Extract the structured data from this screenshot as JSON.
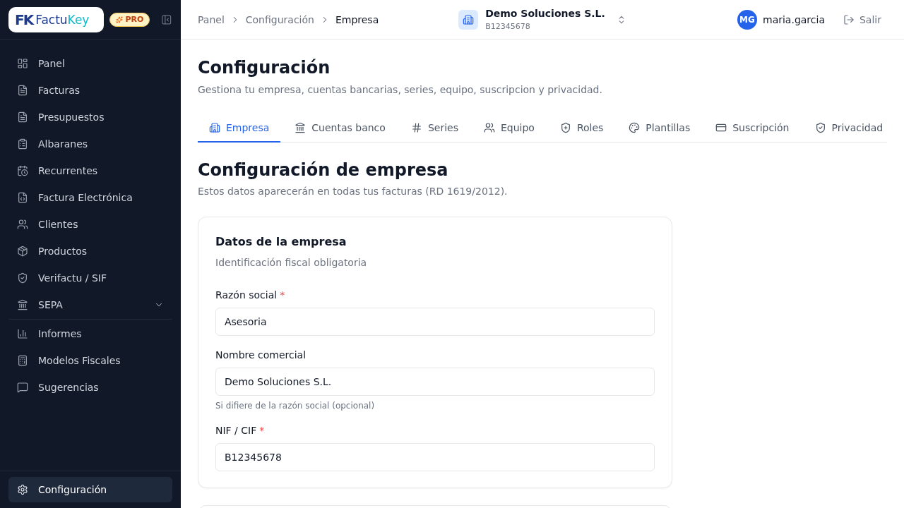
{
  "sidebar": {
    "logo": {
      "mark": "FK",
      "word_start": "Factu",
      "word_end": "Key"
    },
    "plan_badge": "PRO",
    "nav_groups": [
      {
        "items": [
          {
            "kind": "link",
            "label": "Panel",
            "selected": false
          },
          {
            "kind": "link",
            "label": "Facturas",
            "selected": false
          },
          {
            "kind": "link",
            "label": "Presupuestos",
            "selected": false
          },
          {
            "kind": "link",
            "label": "Albaranes",
            "selected": false
          },
          {
            "kind": "link",
            "label": "Recurrentes",
            "selected": false
          },
          {
            "kind": "link",
            "label": "Factura Electrónica",
            "selected": false
          },
          {
            "kind": "link",
            "label": "Clientes",
            "selected": false
          },
          {
            "kind": "link",
            "label": "Productos",
            "selected": false
          },
          {
            "kind": "link",
            "label": "Verifactu / SIF",
            "selected": false
          },
          {
            "kind": "group",
            "label": "SEPA",
            "selected": false,
            "expanded": false
          }
        ]
      },
      {
        "items": [
          {
            "kind": "link",
            "label": "Informes",
            "selected": false
          },
          {
            "kind": "link",
            "label": "Modelos Fiscales",
            "selected": false
          },
          {
            "kind": "link",
            "label": "Sugerencias",
            "selected": false
          }
        ]
      }
    ],
    "footer_item": {
      "label": "Configuración",
      "selected": true
    }
  },
  "topbar": {
    "breadcrumb": [
      {
        "label": "Panel",
        "current": false
      },
      {
        "label": "Configuración",
        "current": false
      },
      {
        "label": "Empresa",
        "current": true
      }
    ],
    "company": {
      "name": "Demo Soluciones S.L.",
      "tax_id": "B12345678"
    },
    "user": {
      "initials": "MG",
      "name": "maria.garcia"
    },
    "logout": "Salir"
  },
  "page": {
    "title": "Configuración",
    "subtitle": "Gestiona tu empresa, cuentas bancarias, series, equipo, suscripcion y privacidad."
  },
  "tabs": [
    {
      "label": "Empresa",
      "selected": true
    },
    {
      "label": "Cuentas banco",
      "selected": false
    },
    {
      "label": "Series",
      "selected": false
    },
    {
      "label": "Equipo",
      "selected": false
    },
    {
      "label": "Roles",
      "selected": false
    },
    {
      "label": "Plantillas",
      "selected": false
    },
    {
      "label": "Suscripción",
      "selected": false
    },
    {
      "label": "Privacidad",
      "selected": false
    }
  ],
  "section": {
    "title": "Configuración de empresa",
    "subtitle": "Estos datos aparecerán en todas tus facturas (RD 1619/2012)."
  },
  "card": {
    "title": "Datos de la empresa",
    "subtitle": "Identificación fiscal obligatoria",
    "fields": [
      {
        "label": "Razón social",
        "marker": "*",
        "value": "Asesoria"
      },
      {
        "label": "Nombre comercial",
        "value": "Demo Soluciones S.L.",
        "help": "Si difiere de la razón social (opcional)"
      },
      {
        "label": "NIF / CIF",
        "marker": "*",
        "value": "B12345678"
      }
    ]
  }
}
